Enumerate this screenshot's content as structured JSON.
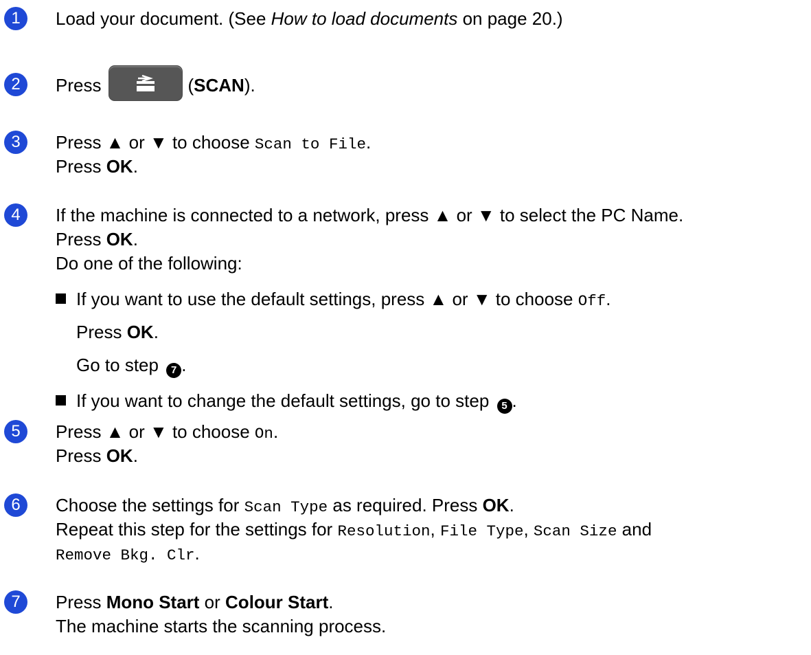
{
  "steps": [
    {
      "number": "1",
      "lines": [
        {
          "segments": [
            {
              "text": "Load your document. (See ",
              "style": ""
            },
            {
              "text": "How to load documents",
              "style": "i"
            },
            {
              "text": " on page 20.)",
              "style": ""
            }
          ]
        }
      ]
    },
    {
      "number": "2",
      "lines": [
        {
          "segments": [
            {
              "text": "Press",
              "style": ""
            },
            {
              "button": "scan-icon"
            },
            {
              "text": "(",
              "style": ""
            },
            {
              "text": "SCAN",
              "style": "b"
            },
            {
              "text": ").",
              "style": ""
            }
          ]
        }
      ]
    },
    {
      "number": "3",
      "lines": [
        {
          "segments": [
            {
              "text": "Press ▲ or ▼ to choose ",
              "style": ""
            },
            {
              "text": "Scan to File",
              "style": "m"
            },
            {
              "text": ".",
              "style": ""
            }
          ]
        },
        {
          "segments": [
            {
              "text": "Press ",
              "style": ""
            },
            {
              "text": "OK",
              "style": "b"
            },
            {
              "text": ".",
              "style": ""
            }
          ]
        }
      ]
    },
    {
      "number": "4",
      "lines": [
        {
          "segments": [
            {
              "text": "If the machine is connected to a network, press ▲ or ▼ to select the PC Name.",
              "style": ""
            }
          ]
        },
        {
          "segments": [
            {
              "text": "Press ",
              "style": ""
            },
            {
              "text": "OK",
              "style": "b"
            },
            {
              "text": ".",
              "style": ""
            }
          ]
        },
        {
          "segments": [
            {
              "text": "Do one of the following:",
              "style": ""
            }
          ]
        }
      ],
      "bullets": [
        {
          "lines": [
            {
              "segments": [
                {
                  "text": "If you want to use the default settings, press ▲ or ▼ to choose ",
                  "style": ""
                },
                {
                  "text": "Off",
                  "style": "m"
                },
                {
                  "text": ".",
                  "style": ""
                }
              ]
            },
            {
              "segments": [
                {
                  "text": "Press ",
                  "style": ""
                },
                {
                  "text": "OK",
                  "style": "b"
                },
                {
                  "text": ".",
                  "style": ""
                }
              ]
            },
            {
              "segments": [
                {
                  "text": "Go to step ",
                  "style": ""
                },
                {
                  "ref": "7"
                },
                {
                  "text": ".",
                  "style": ""
                }
              ]
            }
          ]
        },
        {
          "lines": [
            {
              "segments": [
                {
                  "text": "If you want to change the default settings, go to step ",
                  "style": ""
                },
                {
                  "ref": "5"
                },
                {
                  "text": ".",
                  "style": ""
                }
              ]
            }
          ]
        }
      ]
    },
    {
      "number": "5",
      "lines": [
        {
          "segments": [
            {
              "text": "Press ▲ or ▼ to choose ",
              "style": ""
            },
            {
              "text": "On",
              "style": "m"
            },
            {
              "text": ".",
              "style": ""
            }
          ]
        },
        {
          "segments": [
            {
              "text": "Press ",
              "style": ""
            },
            {
              "text": "OK",
              "style": "b"
            },
            {
              "text": ".",
              "style": ""
            }
          ]
        }
      ]
    },
    {
      "number": "6",
      "lines": [
        {
          "segments": [
            {
              "text": "Choose the settings for ",
              "style": ""
            },
            {
              "text": "Scan Type",
              "style": "m"
            },
            {
              "text": " as required. Press ",
              "style": ""
            },
            {
              "text": "OK",
              "style": "b"
            },
            {
              "text": ".",
              "style": ""
            }
          ]
        },
        {
          "segments": [
            {
              "text": "Repeat this step for the settings for ",
              "style": ""
            },
            {
              "text": "Resolution",
              "style": "m"
            },
            {
              "text": ", ",
              "style": ""
            },
            {
              "text": "File Type",
              "style": "m"
            },
            {
              "text": ", ",
              "style": ""
            },
            {
              "text": "Scan Size",
              "style": "m"
            },
            {
              "text": " and",
              "style": ""
            }
          ]
        },
        {
          "segments": [
            {
              "text": "Remove Bkg. Clr",
              "style": "m"
            },
            {
              "text": ".",
              "style": ""
            }
          ]
        }
      ]
    },
    {
      "number": "7",
      "lines": [
        {
          "segments": [
            {
              "text": "Press ",
              "style": ""
            },
            {
              "text": "Mono Start",
              "style": "b"
            },
            {
              "text": " or ",
              "style": ""
            },
            {
              "text": "Colour Start",
              "style": "b"
            },
            {
              "text": ".",
              "style": ""
            }
          ]
        },
        {
          "segments": [
            {
              "text": "The machine starts the scanning process.",
              "style": ""
            }
          ]
        }
      ]
    }
  ]
}
